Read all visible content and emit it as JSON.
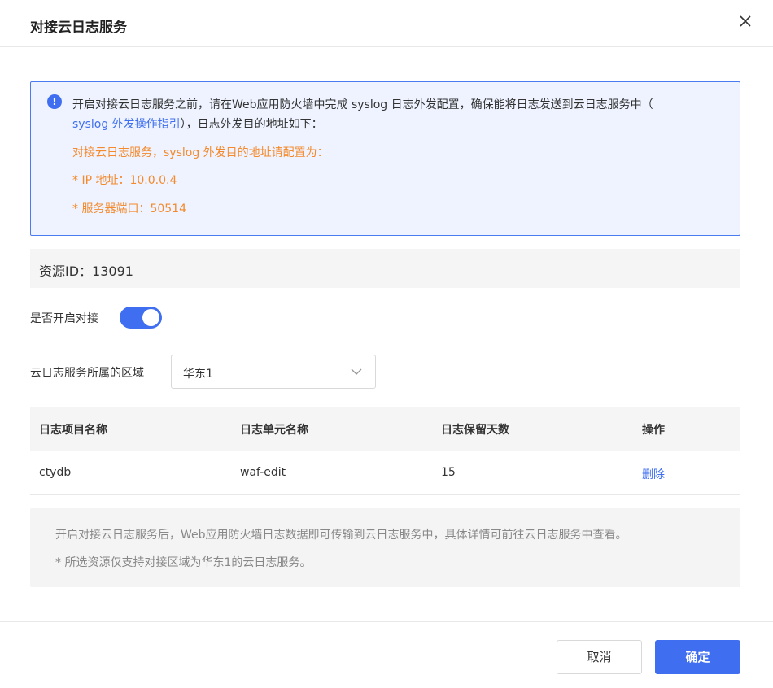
{
  "dialog": {
    "title": "对接云日志服务"
  },
  "notice": {
    "line1": "开启对接云日志服务之前，请在Web应用防火墙中完成 syslog 日志外发配置，确保能将日志发送到云日志服务中（",
    "link": "syslog 外发操作指引",
    "line2_tail": "），日志外发目的地址如下：",
    "orange_title": "对接云日志服务，syslog 外发目的地址请配置为：",
    "ip": "* IP 地址：10.0.0.4",
    "port": "* 服务器端口：50514"
  },
  "resource": {
    "text": "资源ID：13091"
  },
  "toggle": {
    "label": "是否开启对接",
    "on": true
  },
  "region": {
    "label": "云日志服务所属的区域",
    "value": "华东1"
  },
  "table": {
    "headers": [
      "日志项目名称",
      "日志单元名称",
      "日志保留天数",
      "操作"
    ],
    "rows": [
      [
        "ctydb",
        "waf-edit",
        "15",
        "删除"
      ]
    ]
  },
  "info": {
    "line1": "开启对接云日志服务后，Web应用防火墙日志数据即可传输到云日志服务中，具体详情可前往云日志服务中查看。",
    "line2": "* 所选资源仅支持对接区域为华东1的云日志服务。"
  },
  "footer": {
    "cancel": "取消",
    "ok": "确定"
  },
  "colors": {
    "accent": "#3f6ff0",
    "warning": "#f48a2c",
    "notice_bg": "#eef3ff"
  },
  "icons": {
    "close": "close-icon",
    "info": "exclamation-circle-icon",
    "dropdown": "chevron-down-icon"
  }
}
